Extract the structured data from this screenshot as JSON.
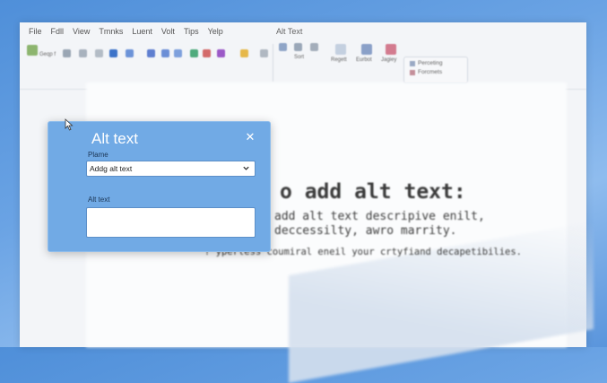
{
  "menu": {
    "items": [
      "File",
      "Fdll",
      "View",
      "Tmnks",
      "Luent",
      "Volt",
      "Tips",
      "Yelp"
    ],
    "window_title": "Alt Text"
  },
  "ribbon": {
    "font_name": "Geqp f",
    "labels": [
      "Sort",
      "Regett",
      "Eurbot",
      "Jagiey"
    ],
    "panel_items": [
      "Perceting",
      "Forcmets"
    ]
  },
  "dialog": {
    "title": "Alt text",
    "close_icon": "close-icon",
    "plane_label": "Plame",
    "select_value": "Addg alt text",
    "alt_label": "Alt text",
    "alt_value": ""
  },
  "document": {
    "heading": "o add alt text:",
    "line1": "add alt text descripive enilt,",
    "line2": "deccessilty, awro marrity.",
    "line3": "? yperless coumiral eneil your crtyfiand decapetibilies."
  },
  "colors": {
    "dialog_bg": "#71aae5",
    "desktop": "#5a95dc",
    "window_bg": "#f3f5f8"
  }
}
